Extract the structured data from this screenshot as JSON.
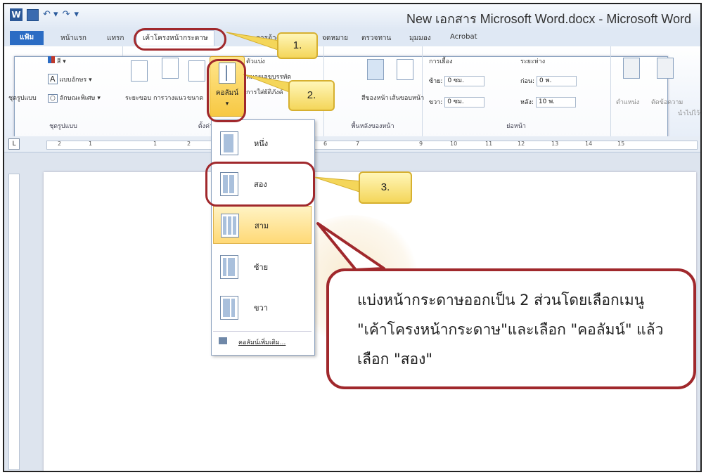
{
  "window": {
    "title": "New เอกสาร Microsoft Word.docx - Microsoft Word"
  },
  "tabs": [
    {
      "label": "แฟ้ม"
    },
    {
      "label": "หน้าแรก"
    },
    {
      "label": "แทรก"
    },
    {
      "label": "เค้าโครงหน้ากระดาษ"
    },
    {
      "label": "การอ้างอิง"
    },
    {
      "label": "จดหมาย"
    },
    {
      "label": "ตรวจทาน"
    },
    {
      "label": "มุมมอง"
    },
    {
      "label": "Acrobat"
    }
  ],
  "ribbon": {
    "themes": {
      "group_label": "ชุดรูปแบบ",
      "theme_button": "ชุดรูปแบบ",
      "colors": "สี",
      "fonts": "แบบอักษร",
      "effects": "ลักษณะพิเศษ"
    },
    "page_setup": {
      "group_label": "ตั้งค่าหน้ากระดาษ",
      "margins": "ระยะขอบ",
      "orientation": "การวางแนว",
      "size": "ขนาด",
      "columns": "คอลัมน์",
      "breaks": "ตัวแบ่ง",
      "line_numbers": "หมายเลขบรรทัด",
      "hyphenation": "การใส่ยัติภังค์"
    },
    "page_background": {
      "group_label": "พื้นหลังของหน้า",
      "page_color": "สีของหน้า",
      "page_borders": "เส้นขอบหน้า"
    },
    "paragraph": {
      "group_label": "ย่อหน้า",
      "indent_label": "การเยื้อง",
      "left_label": "ซ้าย:",
      "left_value": "0 ซม.",
      "right_label": "ขวา:",
      "right_value": "0 ซม.",
      "spacing_label": "ระยะห่าง",
      "before_label": "ก่อน:",
      "before_value": "0 พ.",
      "after_label": "หลัง:",
      "after_value": "10 พ."
    },
    "arrange": {
      "position": "ตำแหน่ง",
      "wrap_text": "ตัดข้อความ",
      "bring_forward": "นำไปไว้ข้างหน้า"
    }
  },
  "ruler_numbers": [
    "2",
    "1",
    "1",
    "2",
    "6",
    "7",
    "9",
    "10",
    "11",
    "12",
    "13",
    "14",
    "15"
  ],
  "columns_menu": {
    "options": [
      "หนึ่ง",
      "สอง",
      "สาม",
      "ซ้าย",
      "ขวา"
    ],
    "more": "คอลัมน์เพิ่มเติม..."
  },
  "callouts": {
    "step1": "1.",
    "step2": "2.",
    "step3": "3."
  },
  "instruction": {
    "line1": "แบ่งหน้ากระดาษออกเป็น 2 ส่วนโดยเลือกเมนู",
    "line2": "\"เค้าโครงหน้ากระดาษ\"และเลือก \"คอลัมน์\" แล้ว",
    "line3": "เลือก \"สอง\""
  },
  "colors": {
    "annotation_ring": "#a0282c",
    "callout_fill": "#f4d65a",
    "file_tab": "#2b6cc4",
    "highlight": "#ffd976"
  }
}
